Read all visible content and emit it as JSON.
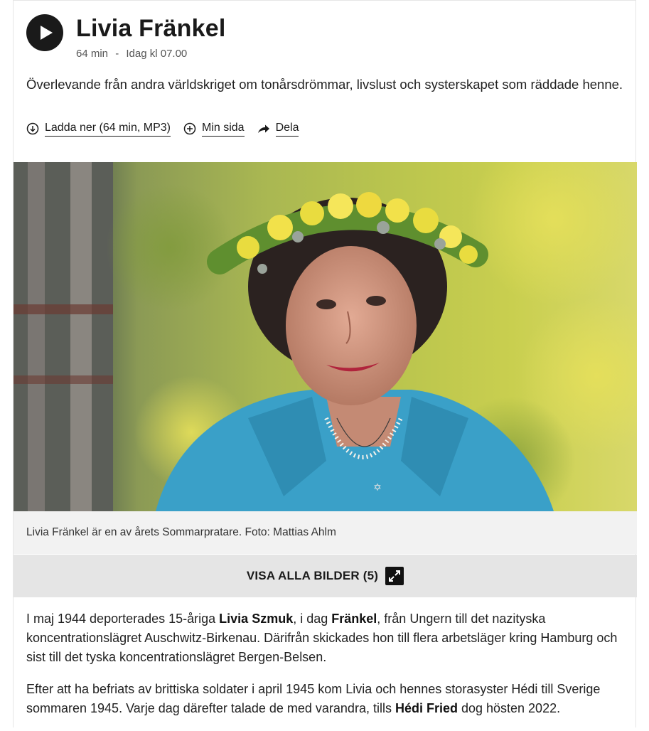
{
  "episode": {
    "title": "Livia Fränkel",
    "duration": "64 min",
    "separator": "-",
    "air_time": "Idag kl 07.00",
    "description": "Överlevande från andra världskriget om tonårsdrömmar, livslust och systerskapet som räddade henne."
  },
  "actions": {
    "download_label": "Ladda ner (64 min, MP3)",
    "mypage_label": "Min sida",
    "share_label": "Dela"
  },
  "image": {
    "caption": "Livia Fränkel är en av årets Sommarpratare. Foto: Mattias Ahlm",
    "gallery_label": "VISA ALLA BILDER (5)"
  },
  "article": {
    "p1": {
      "t1": "I maj 1944 deporterades 15-åriga ",
      "b1": "Livia Szmuk",
      "t2": ", i dag ",
      "b2": "Fränkel",
      "t3": ", från Ungern till det nazityska koncentrationslägret Auschwitz-Birkenau. Därifrån skickades hon till flera arbetsläger kring Hamburg och sist till det tyska koncentrationslägret Bergen-Belsen."
    },
    "p2": {
      "t1": "Efter att ha befriats av brittiska soldater i april 1945 kom Livia och hennes storasyster Hédi till Sverige sommaren 1945. Varje dag därefter talade de med varandra, tills ",
      "b1": "Hédi Fried",
      "t2": " dog hösten 2022."
    }
  },
  "colors": {
    "accent": "#1a1a1a",
    "caption_bg": "#f2f2f2",
    "gallery_bg": "#e5e5e5",
    "shirt": "#3aa0c8"
  },
  "icons": [
    "play-icon",
    "download-icon",
    "add-icon",
    "share-icon",
    "expand-icon"
  ]
}
